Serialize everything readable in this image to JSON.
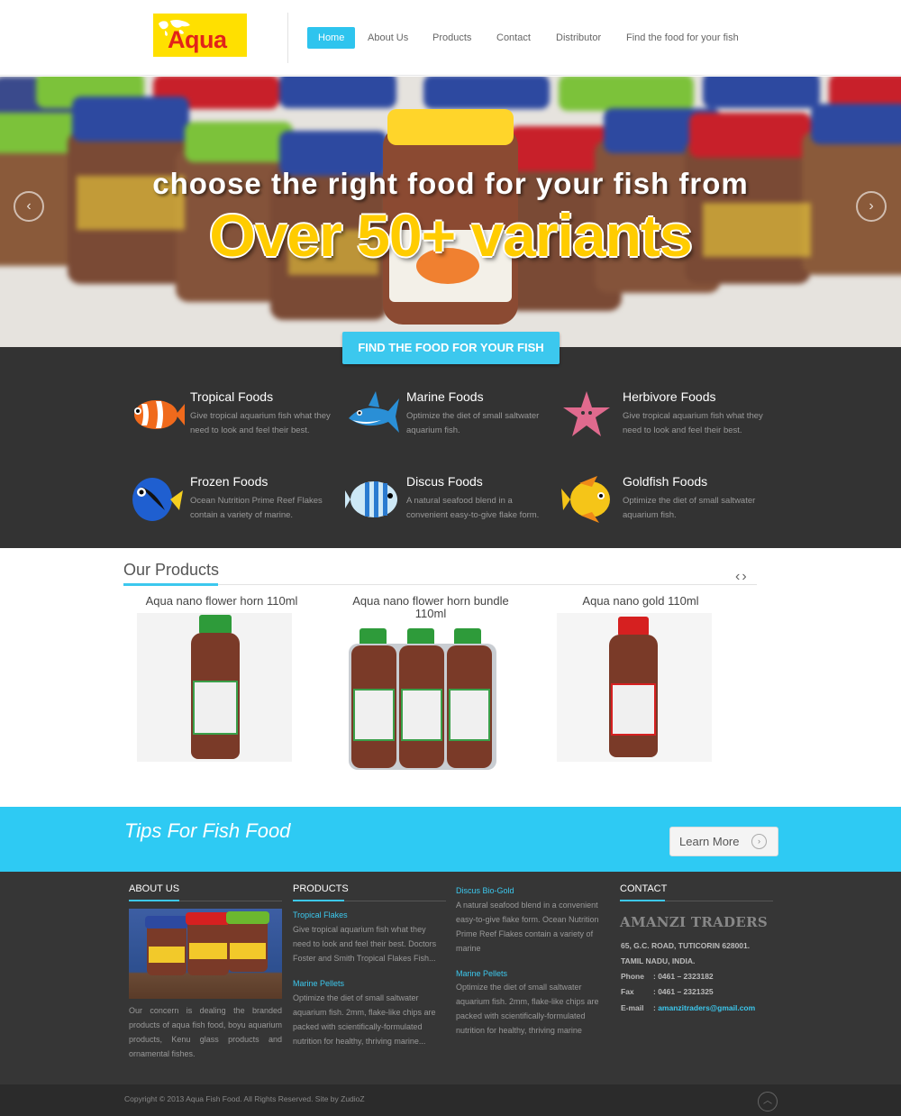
{
  "header": {
    "logo_text": "Aqua",
    "nav": [
      {
        "label": "Home"
      },
      {
        "label": "About Us"
      },
      {
        "label": "Products"
      },
      {
        "label": "Contact"
      },
      {
        "label": "Distributor"
      },
      {
        "label": "Find the food for your fish"
      }
    ]
  },
  "hero": {
    "line1": "choose the right food for your fish from",
    "line2": "Over 50+ variants"
  },
  "find": {
    "button": "FIND THE FOOD FOR YOUR FISH",
    "items": [
      {
        "title": "Tropical Foods",
        "desc": "Give tropical aquarium fish what they need to look and feel their best.",
        "icon": "clownfish-icon"
      },
      {
        "title": "Marine Foods",
        "desc": "Optimize the diet of small saltwater aquarium fish.",
        "icon": "shark-icon"
      },
      {
        "title": "Herbivore Foods",
        "desc": "Give tropical aquarium fish what they need to look and feel their best.",
        "icon": "starfish-icon"
      },
      {
        "title": "Frozen Foods",
        "desc": "Ocean Nutrition Prime Reef Flakes contain a variety of marine.",
        "icon": "blue-tang-icon"
      },
      {
        "title": "Discus Foods",
        "desc": "A natural seafood blend in a convenient easy-to-give flake form.",
        "icon": "striped-fish-icon"
      },
      {
        "title": "Goldfish Foods",
        "desc": "Optimize the diet of small saltwater aquarium fish.",
        "icon": "angelfish-icon"
      }
    ]
  },
  "products": {
    "title": "Our Products",
    "nav": "‹›",
    "items": [
      {
        "name": "Aqua nano flower horn 110ml",
        "cap_color": "#2e9b3a"
      },
      {
        "name": "Aqua nano flower horn bundle 110ml",
        "cap_color": "#2e9b3a"
      },
      {
        "name": "Aqua nano gold 110ml",
        "cap_color": "#d62020"
      }
    ]
  },
  "tips": {
    "text": "Tips For Fish Food",
    "button": "Learn More"
  },
  "footer": {
    "about": {
      "title": "ABOUT US",
      "text": "Our concern is dealing the branded products of aqua fish food, boyu aquarium products, Kenu glass products and ornamental fishes."
    },
    "products": {
      "title": "PRODUCTS",
      "items": [
        {
          "title": "Tropical Flakes",
          "text": "Give tropical aquarium fish what they need to look and feel their best. Doctors Foster and Smith Tropical Flakes Fish..."
        },
        {
          "title": "Marine Pellets",
          "text": "Optimize the diet of small saltwater aquarium fish. 2mm, flake-like chips are packed with scientifically-formulated nutrition for healthy, thriving marine..."
        }
      ]
    },
    "products2": {
      "items": [
        {
          "title": "Discus Bio-Gold",
          "text": "A natural seafood blend in a convenient easy-to-give flake form. Ocean Nutrition Prime Reef Flakes contain a variety of marine"
        },
        {
          "title": "Marine Pellets",
          "text": "Optimize the diet of small saltwater aquarium fish. 2mm, flake-like chips are packed with scientifically-formulated nutrition for healthy, thriving marine"
        }
      ]
    },
    "contact": {
      "title": "CONTACT",
      "company": "AMANZI TRADERS",
      "address1": "65, G.C. ROAD, TUTICORIN 628001.",
      "address2": "TAMIL NADU, INDIA.",
      "phone_label": "Phone",
      "phone": ": 0461 – 2323182",
      "fax_label": "Fax",
      "fax": ": 0461 – 2321325",
      "email_label": "E-mail",
      "email": "amanzitraders@gmail.com"
    },
    "copyright": "Copyright © 2013 Aqua Fish Food. All Rights Reserved. Site by ZudioZ"
  }
}
